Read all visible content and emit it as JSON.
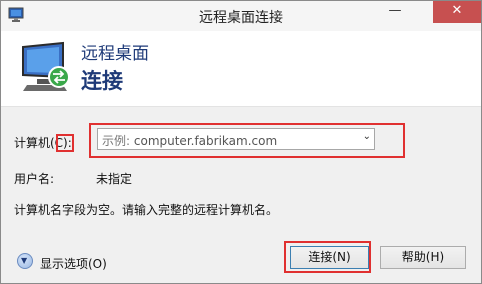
{
  "window": {
    "title": "远程桌面连接",
    "minimize_glyph": "—",
    "close_glyph": "✕"
  },
  "header": {
    "line1": "远程桌面",
    "line2": "连接"
  },
  "form": {
    "computer_label": "计算机(C):",
    "computer_placeholder_prefix": "示例:",
    "computer_placeholder_value": "computer.fabrikam.com",
    "username_label": "用户名:",
    "username_value": "未指定",
    "message": "计算机名字段为空。请输入完整的远程计算机名。"
  },
  "footer": {
    "show_options": "显示选项(O)",
    "connect_button": "连接(N)",
    "help_button": "帮助(H)"
  },
  "colors": {
    "accent_title": "#1e3a78",
    "highlight_red": "#e03030"
  }
}
